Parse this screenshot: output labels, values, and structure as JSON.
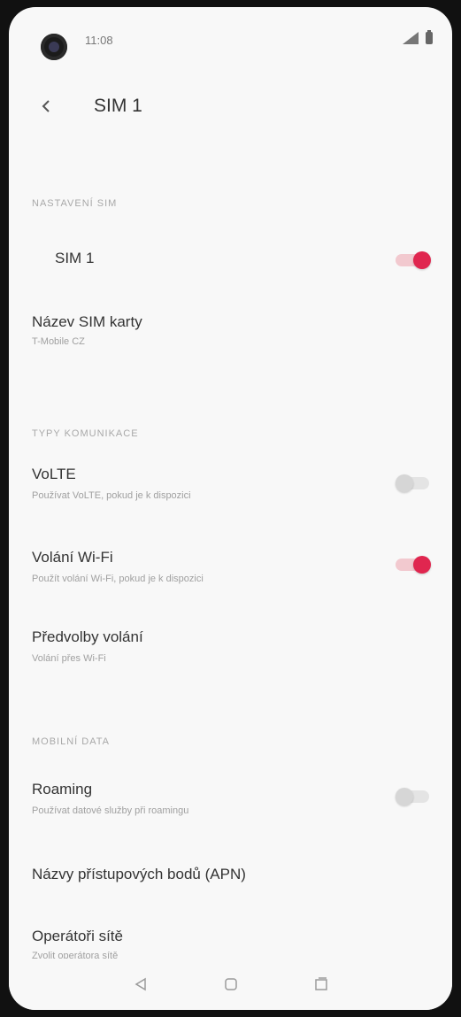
{
  "status_bar": {
    "time": "11:08"
  },
  "header": {
    "title": "SIM 1"
  },
  "sections": {
    "sim_settings": "NASTAVENÍ SIM",
    "calls": "TYPY KOMUNIKACE",
    "mobile_data": "MOBILNÍ DATA"
  },
  "items": {
    "sim_toggle": {
      "title": "SIM 1",
      "on": true
    },
    "sim_name": {
      "title": "Název SIM karty",
      "subtitle": "T-Mobile CZ"
    },
    "volte": {
      "title": "VoLTE",
      "subtitle": "Používat VoLTE, pokud je k dispozici",
      "on": false
    },
    "wifi_calling": {
      "title": "Volání Wi-Fi",
      "subtitle": "Použít volání Wi-Fi, pokud je k dispozici",
      "on": true
    },
    "call_prefs": {
      "title": "Předvolby volání",
      "subtitle": "Volání přes Wi-Fi"
    },
    "roaming": {
      "title": "Roaming",
      "subtitle": "Používat datové služby při roamingu",
      "on": false
    },
    "apn": {
      "title": "Názvy přístupových bodů (APN)"
    },
    "operators": {
      "title": "Operátoři sítě",
      "subtitle": "Zvolit operátora sítě"
    }
  },
  "icons": {
    "back": "arrow-back-icon",
    "nav_back": "nav-back-icon",
    "nav_home": "nav-home-icon",
    "nav_recents": "nav-recents-icon"
  },
  "colors": {
    "accent": "#e0264f",
    "background": "#f8f8f8"
  }
}
